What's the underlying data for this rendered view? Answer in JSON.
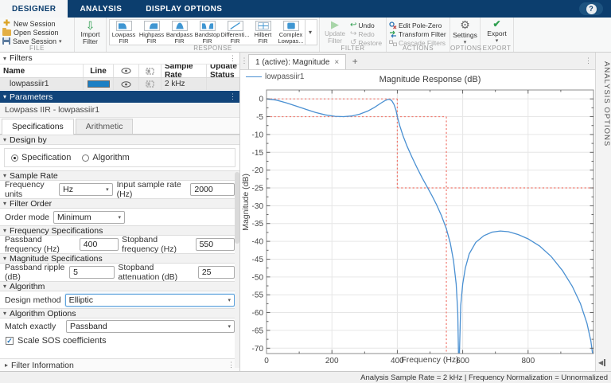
{
  "ribbon": {
    "tabs": [
      {
        "label": "DESIGNER"
      },
      {
        "label": "ANALYSIS"
      },
      {
        "label": "DISPLAY OPTIONS"
      }
    ],
    "help_label": "?",
    "file": {
      "label": "FILE",
      "new_session": "New Session",
      "open_session": "Open Session",
      "save_session": "Save Session",
      "import_filter": "Import Filter"
    },
    "response": {
      "label": "RESPONSE",
      "items": [
        "Lowpass FIR",
        "Highpass FIR",
        "Bandpass FIR",
        "Bandstop FIR",
        "Differenti... FIR",
        "Hilbert FIR",
        "Complex Lowpas..."
      ]
    },
    "filter": {
      "label": "FILTER",
      "update": "Update Filter",
      "undo": "Undo",
      "redo": "Redo",
      "restore": "Restore"
    },
    "actions": {
      "label": "ACTIONS",
      "edit_pole_zero": "Edit Pole-Zero",
      "transform": "Transform Filter",
      "cascade": "Cascade Filters"
    },
    "options": {
      "label": "OPTIONS",
      "settings": "Settings"
    },
    "export": {
      "label": "EXPORT",
      "export": "Export"
    }
  },
  "filters_panel": {
    "title": "Filters",
    "columns": {
      "name": "Name",
      "line": "Line",
      "sample_rate": "Sample Rate",
      "update_status": "Update Status"
    },
    "row": {
      "name": "lowpassiir1",
      "line_color": "#1b7fc4",
      "sample_rate": "2 kHz",
      "update_status": ""
    }
  },
  "parameters_panel": {
    "title": "Parameters",
    "subtitle": "Lowpass IIR - lowpassiir1",
    "tabs": [
      "Specifications",
      "Arithmetic"
    ],
    "design_by": {
      "header": "Design by",
      "options": [
        "Specification",
        "Algorithm"
      ],
      "selected": "Specification"
    },
    "sample_rate": {
      "header": "Sample Rate",
      "freq_units_label": "Frequency units",
      "freq_units_value": "Hz",
      "input_rate_label": "Input sample rate (Hz)",
      "input_rate_value": "2000"
    },
    "filter_order": {
      "header": "Filter Order",
      "order_mode_label": "Order mode",
      "order_mode_value": "Minimum"
    },
    "frequency_specs": {
      "header": "Frequency Specifications",
      "passband_label": "Passband frequency (Hz)",
      "passband_value": "400",
      "stopband_label": "Stopband frequency (Hz)",
      "stopband_value": "550"
    },
    "magnitude_specs": {
      "header": "Magnitude Specifications",
      "ripple_label": "Passband ripple (dB)",
      "ripple_value": "5",
      "atten_label": "Stopband attenuation (dB)",
      "atten_value": "25"
    },
    "algorithm": {
      "header": "Algorithm",
      "design_method_label": "Design method",
      "design_method_value": "Elliptic"
    },
    "algorithm_options": {
      "header": "Algorithm Options",
      "match_label": "Match exactly",
      "match_value": "Passband",
      "checkbox_label": "Scale SOS coefficients",
      "checkbox_checked": true
    },
    "filter_information": {
      "header": "Filter Information"
    }
  },
  "figure": {
    "tab_label": "1 (active): Magnitude",
    "tab_close": "×",
    "tab_add": "+",
    "analysis_strip": "ANALYSIS OPTIONS"
  },
  "status_bar": {
    "text": "Analysis Sample Rate = 2 kHz | Frequency Normalization = Unnormalized"
  },
  "chart_data": {
    "type": "line",
    "title": "Magnitude Response (dB)",
    "xlabel": "Frequency (Hz)",
    "ylabel": "Magnitude (dB)",
    "xlim": [
      0,
      1000
    ],
    "ylim": [
      -71.5,
      2.5
    ],
    "x_major_ticks": [
      0,
      200,
      400,
      600,
      800
    ],
    "x_minor_step": 100,
    "y_major_ticks": [
      0,
      -5,
      -10,
      -15,
      -20,
      -25,
      -30,
      -35,
      -40,
      -45,
      -50,
      -55,
      -60,
      -65,
      -70
    ],
    "y_minor_step": 2.5,
    "grid": true,
    "legend": {
      "position": "top-left",
      "entries": [
        {
          "label": "lowpassiir1",
          "color": "#4a90d2"
        }
      ]
    },
    "mask": {
      "color": "#f0776c",
      "style": "dotted",
      "segments": [
        [
          [
            0,
            0
          ],
          [
            400,
            0
          ]
        ],
        [
          [
            400,
            0
          ],
          [
            400,
            -25
          ]
        ],
        [
          [
            400,
            -25
          ],
          [
            1000,
            -25
          ]
        ],
        [
          [
            0,
            -5
          ],
          [
            550,
            -5
          ]
        ],
        [
          [
            550,
            -5
          ],
          [
            550,
            -71.5
          ]
        ]
      ]
    },
    "series": [
      {
        "name": "lowpassiir1",
        "color": "#4a90d2",
        "points": [
          [
            0,
            0
          ],
          [
            30,
            -0.35
          ],
          [
            60,
            -1.1
          ],
          [
            90,
            -2.0
          ],
          [
            120,
            -2.9
          ],
          [
            150,
            -3.8
          ],
          [
            180,
            -4.5
          ],
          [
            210,
            -4.9
          ],
          [
            235,
            -5
          ],
          [
            260,
            -4.8
          ],
          [
            285,
            -4.3
          ],
          [
            310,
            -3.4
          ],
          [
            330,
            -2.4
          ],
          [
            350,
            -1.2
          ],
          [
            362,
            -0.5
          ],
          [
            371,
            -0.15
          ],
          [
            377,
            -0.15
          ],
          [
            383,
            -0.5
          ],
          [
            390,
            -1.6
          ],
          [
            396,
            -3.2
          ],
          [
            400,
            -5
          ],
          [
            408,
            -7.7
          ],
          [
            418,
            -10.5
          ],
          [
            430,
            -13.3
          ],
          [
            445,
            -16.4
          ],
          [
            460,
            -19.3
          ],
          [
            475,
            -22
          ],
          [
            490,
            -24.5
          ],
          [
            505,
            -27
          ],
          [
            520,
            -29.7
          ],
          [
            535,
            -32.8
          ],
          [
            550,
            -36.5
          ],
          [
            562,
            -40.5
          ],
          [
            572,
            -45.5
          ],
          [
            580,
            -52
          ],
          [
            585,
            -60
          ],
          [
            587,
            -71.5
          ],
          [
            590,
            -71.5
          ],
          [
            594,
            -58
          ],
          [
            600,
            -52
          ],
          [
            608,
            -47.5
          ],
          [
            620,
            -43.5
          ],
          [
            640,
            -40.3
          ],
          [
            665,
            -38.4
          ],
          [
            690,
            -37.4
          ],
          [
            715,
            -37.1
          ],
          [
            740,
            -37.3
          ],
          [
            770,
            -38.1
          ],
          [
            800,
            -39.3
          ],
          [
            835,
            -41.3
          ],
          [
            870,
            -44.2
          ],
          [
            905,
            -48.2
          ],
          [
            935,
            -52.6
          ],
          [
            960,
            -57.5
          ],
          [
            980,
            -63
          ],
          [
            992,
            -68
          ],
          [
            997,
            -71.5
          ]
        ]
      }
    ]
  }
}
